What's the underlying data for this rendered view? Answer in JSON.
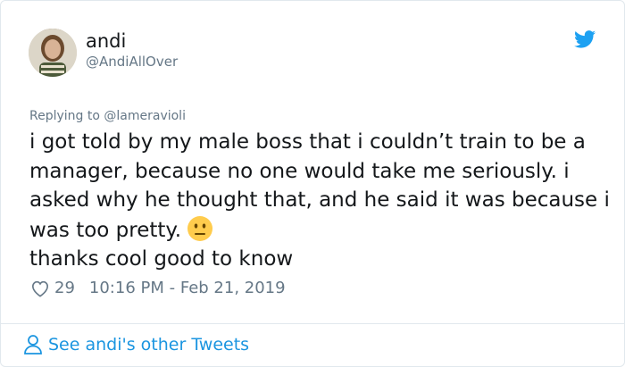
{
  "author": {
    "display_name": "andi",
    "handle": "@AndiAllOver"
  },
  "reply": {
    "prefix": "Replying to ",
    "mention": "@lameravioli"
  },
  "tweet": {
    "line1": "i got told by my male boss that i couldn’t train to be a manager, because no one would take me seriously. i asked why he thought that, and he said it was because i was too pretty.",
    "emoji": "neutral-face-emoji",
    "line2": "thanks cool good to know",
    "like_count": "29",
    "timestamp": "10:16 PM - Feb 21, 2019"
  },
  "footer": {
    "link_label": "See andi's other Tweets"
  },
  "colors": {
    "brand_blue": "#1da1f2",
    "link_blue": "#1b95e0",
    "muted_gray": "#657786",
    "border": "#e1e8ed"
  },
  "icons": {
    "bird": "twitter-bird-icon",
    "heart": "heart-outline-icon",
    "user": "user-outline-icon"
  }
}
